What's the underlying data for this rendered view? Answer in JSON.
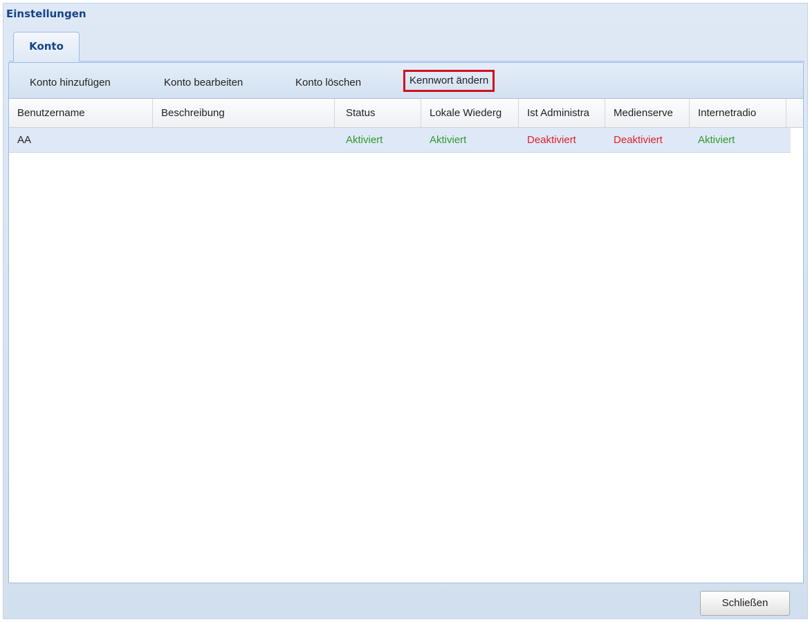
{
  "window": {
    "title": "Einstellungen"
  },
  "tabs": [
    {
      "label": "Konto",
      "active": true
    }
  ],
  "toolbar": {
    "add": "Konto hinzufügen",
    "edit": "Konto bearbeiten",
    "delete": "Konto löschen",
    "change_password": "Kennwort ändern"
  },
  "table": {
    "columns": [
      "Benutzername",
      "Beschreibung",
      "Status",
      "Lokale Wiederg",
      "Ist Administra",
      "Medienserve",
      "Internetradio"
    ],
    "rows": [
      {
        "username": "AA",
        "description": "",
        "status": "Aktiviert",
        "local_playback": "Aktiviert",
        "is_admin": "Deaktiviert",
        "media_server": "Deaktiviert",
        "internet_radio": "Aktiviert"
      }
    ]
  },
  "footer": {
    "close": "Schließen"
  },
  "colors": {
    "enabled": "#2e9a2e",
    "disabled": "#e0202a",
    "title": "#15428b",
    "highlight": "#d0101c"
  }
}
